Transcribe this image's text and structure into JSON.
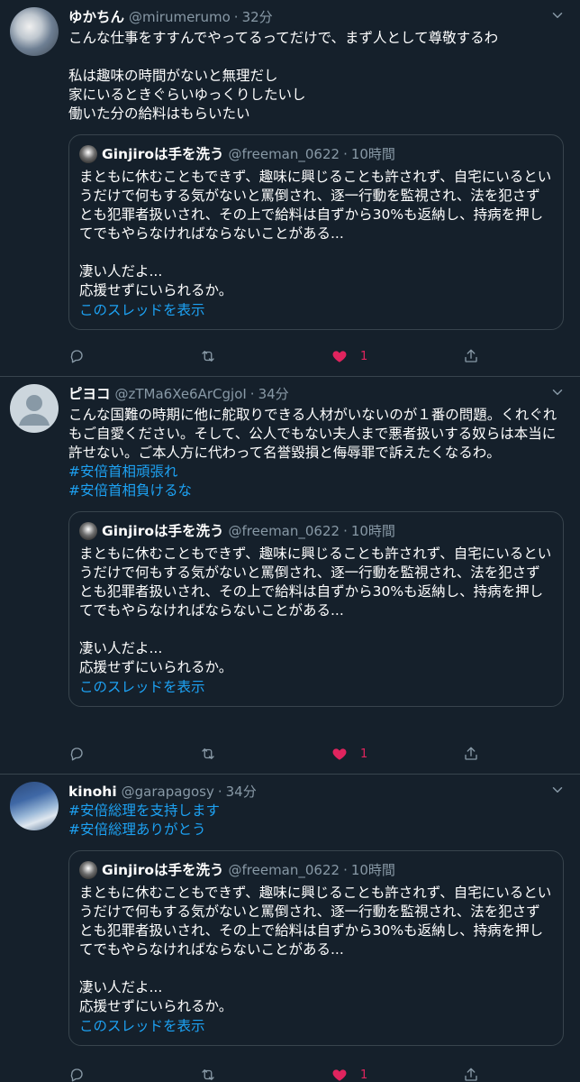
{
  "tweets": [
    {
      "name": "ゆかちん",
      "handle": "@mirumerumo",
      "dot": "·",
      "time": "32分",
      "text": "こんな仕事をすすんでやってるってだけで、まず人として尊敬するわ\n\n私は趣味の時間がないと無理だし\n家にいるときぐらいゆっくりしたいし\n働いた分の給料はもらいたい",
      "hashtags": [],
      "likes": "1"
    },
    {
      "name": "ピヨコ",
      "handle": "@zTMa6Xe6ArCgjoI",
      "dot": "·",
      "time": "34分",
      "text": "こんな国難の時期に他に舵取りできる人材がいないのが１番の問題。くれぐれもご自愛ください。そして、公人でもない夫人まで悪者扱いする奴らは本当に許せない。ご本人方に代わって名誉毀損と侮辱罪で訴えたくなるわ。",
      "hashtags": [
        "#安倍首相頑張れ",
        "#安倍首相負けるな"
      ],
      "likes": "1"
    },
    {
      "name": "kinohi",
      "handle": "@garapagosy",
      "dot": "·",
      "time": "34分",
      "text": "",
      "hashtags": [
        "#安倍総理を支持します",
        "#安倍総理ありがとう"
      ],
      "likes": "1"
    }
  ],
  "quote": {
    "name": "Ginjiroは手を洗う",
    "handle": "@freeman_0622",
    "dot": "·",
    "time": "10時間",
    "text": "まともに休むこともできず、趣味に興じることも許されず、自宅にいるというだけで何もする気がないと罵倒され、逐一行動を監視され、法を犯さずとも犯罪者扱いされ、その上で給料は自ずから30%も返納し、持病を押してでもやらなければならないことがある...\n\n凄い人だよ...\n応援せずにいられるか。",
    "link": "このスレッドを表示"
  },
  "icons": {
    "reply": "reply-icon",
    "retweet": "retweet-icon",
    "like": "heart-icon",
    "share": "share-icon",
    "caret": "chevron-down-icon"
  },
  "colors": {
    "background": "#15202b",
    "border": "#38444d",
    "secondary_text": "#8899a6",
    "link": "#1da1f2",
    "like": "#e0245e"
  }
}
